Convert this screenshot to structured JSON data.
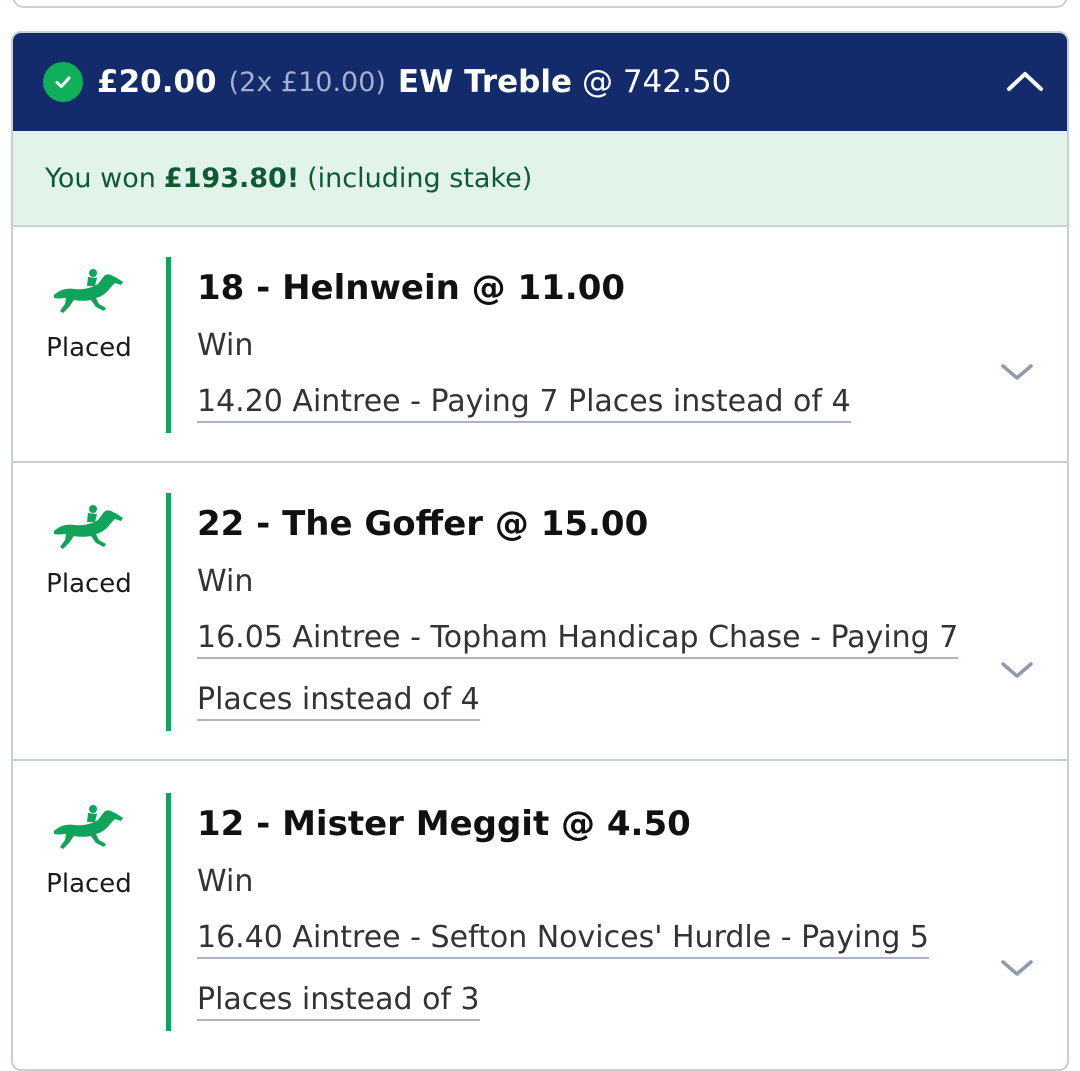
{
  "bet": {
    "stake": "£20.00",
    "each_way": "(2x £10.00)",
    "bet_type": "EW Treble",
    "odds": "@ 742.50",
    "status_icon": "check-circle-icon",
    "collapse_icon": "chevron-up-icon",
    "accent_color": "#132a6b",
    "success_color": "#10b05a"
  },
  "result": {
    "prefix": "You won",
    "amount": "£193.80!",
    "suffix": "(including stake)"
  },
  "selections": [
    {
      "status": "Placed",
      "icon": "horse-racing-icon",
      "title": "18 - Helnwein @ 11.00",
      "market": "Win",
      "event_line1": "14.20 Aintree - Paying 7 Places instead of 4",
      "event_line2": ""
    },
    {
      "status": "Placed",
      "icon": "horse-racing-icon",
      "title": "22 - The Goffer @ 15.00",
      "market": "Win",
      "event_line1": "16.05 Aintree - Topham Handicap Chase - Paying 7",
      "event_line2": "Places instead of 4"
    },
    {
      "status": "Placed",
      "icon": "horse-racing-icon",
      "title": "12 - Mister Meggit @ 4.50",
      "market": "Win",
      "event_line1": "16.40 Aintree - Sefton Novices' Hurdle - Paying 5",
      "event_line2": "Places instead of 3"
    }
  ]
}
